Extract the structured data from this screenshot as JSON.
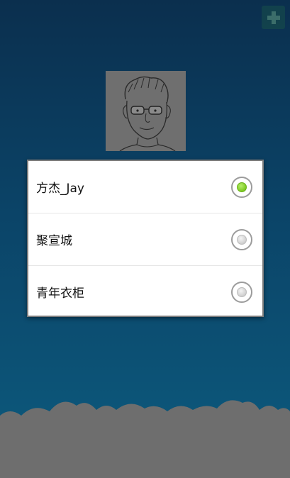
{
  "header": {
    "add_button_icon": "plus-icon"
  },
  "avatar": {
    "icon": "sketch-portrait"
  },
  "dialog": {
    "options": [
      {
        "label": "方杰_Jay",
        "checked": true
      },
      {
        "label": "聚宣城",
        "checked": false
      },
      {
        "label": "青年衣柜",
        "checked": false
      }
    ]
  },
  "colors": {
    "background_top": "#0b2f4e",
    "background_bottom": "#0d5b7e",
    "checked_radio": "#7cc922",
    "clouds": "#6e6e6e"
  }
}
